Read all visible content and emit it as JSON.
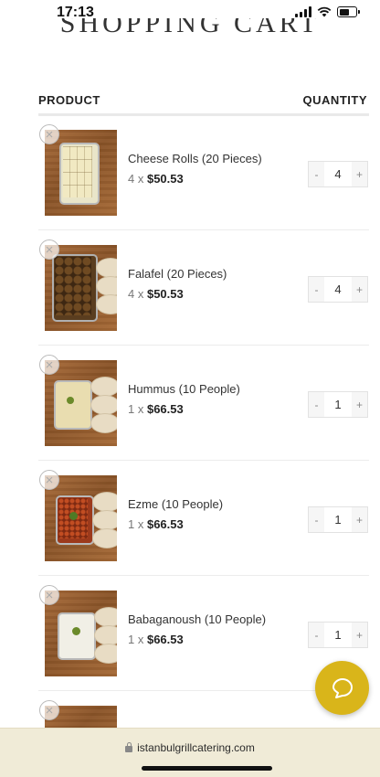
{
  "status_bar": {
    "time": "17:13"
  },
  "page": {
    "title": "SHOPPING CART"
  },
  "table": {
    "product_header": "PRODUCT",
    "quantity_header": "QUANTITY"
  },
  "items": [
    {
      "name": "Cheese Rolls (20 Pieces)",
      "qty_prefix": "4 x",
      "unit_price": "$50.53",
      "quantity": "4",
      "minus": "-",
      "plus": "+"
    },
    {
      "name": "Falafel (20 Pieces)",
      "qty_prefix": "4 x",
      "unit_price": "$50.53",
      "quantity": "4",
      "minus": "-",
      "plus": "+"
    },
    {
      "name": "Hummus (10 People)",
      "qty_prefix": "1 x",
      "unit_price": "$66.53",
      "quantity": "1",
      "minus": "-",
      "plus": "+"
    },
    {
      "name": "Ezme (10 People)",
      "qty_prefix": "1 x",
      "unit_price": "$66.53",
      "quantity": "1",
      "minus": "-",
      "plus": "+"
    },
    {
      "name": "Babaganoush (10 People)",
      "qty_prefix": "1 x",
      "unit_price": "$66.53",
      "quantity": "1",
      "minus": "-",
      "plus": "+"
    }
  ],
  "icons": {
    "remove": "close-circle-icon",
    "chat": "chat-bubble-icon",
    "lock": "lock-icon"
  },
  "browser": {
    "url": "istanbulgrillcatering.com"
  },
  "colors": {
    "accent": "#d9b51a",
    "browser_bar": "#f0ebd7"
  }
}
